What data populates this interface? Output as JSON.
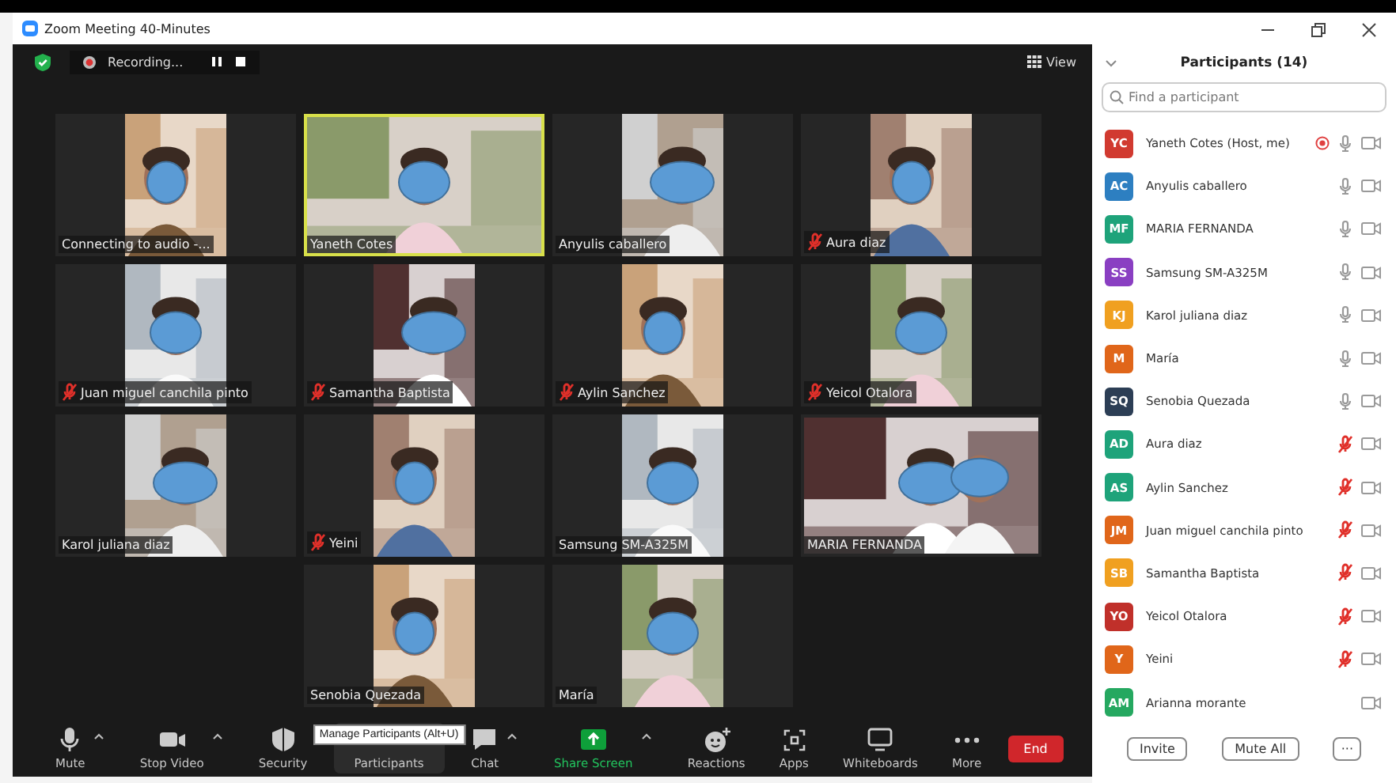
{
  "window": {
    "title": "Zoom Meeting 40-Minutes"
  },
  "meeting_bar": {
    "recording": {
      "label": "Recording..."
    },
    "view_button": "View"
  },
  "video_rows": [
    {
      "tiles": [
        {
          "name": "Connecting to audio -...",
          "muted": false,
          "speaking": false,
          "kind": "narrow"
        },
        {
          "name": "Yaneth Cotes",
          "muted": false,
          "speaking": true,
          "kind": "wide"
        },
        {
          "name": "Anyulis caballero",
          "muted": false,
          "speaking": false,
          "kind": "narrow"
        },
        {
          "name": "Aura diaz",
          "muted": true,
          "speaking": false,
          "kind": "narrow"
        }
      ]
    },
    {
      "tiles": [
        {
          "name": "Juan miguel canchila pinto",
          "muted": true,
          "speaking": false,
          "kind": "narrow"
        },
        {
          "name": "Samantha Baptista",
          "muted": true,
          "speaking": false,
          "kind": "narrow"
        },
        {
          "name": "Aylin Sanchez",
          "muted": true,
          "speaking": false,
          "kind": "narrow"
        },
        {
          "name": "Yeicol Otalora",
          "muted": true,
          "speaking": false,
          "kind": "narrow"
        }
      ]
    },
    {
      "tiles": [
        {
          "name": "Karol juliana diaz",
          "muted": false,
          "speaking": false,
          "kind": "narrow"
        },
        {
          "name": "Yeini",
          "muted": true,
          "speaking": false,
          "kind": "narrow"
        },
        {
          "name": "Samsung SM-A325M",
          "muted": false,
          "speaking": false,
          "kind": "narrow"
        },
        {
          "name": "MARIA FERNANDA",
          "muted": false,
          "speaking": false,
          "kind": "wide"
        }
      ]
    },
    {
      "tiles": [
        {
          "name": "Senobia Quezada",
          "muted": false,
          "speaking": false,
          "kind": "narrow"
        },
        {
          "name": "María",
          "muted": false,
          "speaking": false,
          "kind": "narrow"
        }
      ]
    }
  ],
  "toolbar": {
    "buttons": [
      {
        "label": "Mute",
        "selected": false,
        "color": "#c8c8c8",
        "caret": true
      },
      {
        "label": "Stop Video",
        "selected": false,
        "color": "#c8c8c8",
        "caret": true
      },
      {
        "label": "Security",
        "selected": false,
        "color": "#c8c8c8",
        "caret": false
      },
      {
        "label": "Participants",
        "selected": true,
        "color": "#c8c8c8",
        "caret": false
      },
      {
        "label": "Chat",
        "selected": false,
        "color": "#c8c8c8",
        "caret": true
      },
      {
        "label": "Share Screen",
        "selected": false,
        "color": "#22c55e",
        "caret": true
      },
      {
        "label": "Reactions",
        "selected": false,
        "color": "#c8c8c8",
        "caret": false
      },
      {
        "label": "Apps",
        "selected": false,
        "color": "#c8c8c8",
        "caret": false
      },
      {
        "label": "Whiteboards",
        "selected": false,
        "color": "#c8c8c8",
        "caret": false
      },
      {
        "label": "More",
        "selected": false,
        "color": "#c8c8c8",
        "caret": false
      }
    ],
    "tooltip": "Manage Participants (Alt+U)",
    "end_button": "End"
  },
  "participants_panel": {
    "title": "Participants (14)",
    "search": {
      "placeholder": "Find a participant"
    },
    "participants": [
      {
        "initials": "YC",
        "name": "Yaneth Cotes (Host, me)",
        "color": "#d13a30",
        "muted": false,
        "has_audio": true,
        "recording": true
      },
      {
        "initials": "AC",
        "name": "Anyulis caballero",
        "color": "#2d7fc1",
        "muted": false,
        "has_audio": true,
        "recording": false
      },
      {
        "initials": "MF",
        "name": "MARIA FERNANDA",
        "color": "#1ea37a",
        "muted": false,
        "has_audio": true,
        "recording": false
      },
      {
        "initials": "SS",
        "name": "Samsung SM-A325M",
        "color": "#8a3fc2",
        "muted": false,
        "has_audio": true,
        "recording": false
      },
      {
        "initials": "KJ",
        "name": "Karol juliana diaz",
        "color": "#f0a020",
        "muted": false,
        "has_audio": true,
        "recording": false
      },
      {
        "initials": "M",
        "name": "María",
        "color": "#e0661a",
        "muted": false,
        "has_audio": true,
        "recording": false
      },
      {
        "initials": "SQ",
        "name": "Senobia Quezada",
        "color": "#2c3e55",
        "muted": false,
        "has_audio": true,
        "recording": false
      },
      {
        "initials": "AD",
        "name": "Aura diaz",
        "color": "#1ea37a",
        "muted": true,
        "has_audio": true,
        "recording": false
      },
      {
        "initials": "AS",
        "name": "Aylin Sanchez",
        "color": "#1ea37a",
        "muted": true,
        "has_audio": true,
        "recording": false
      },
      {
        "initials": "JM",
        "name": "Juan miguel canchila pinto",
        "color": "#e0661a",
        "muted": true,
        "has_audio": true,
        "recording": false
      },
      {
        "initials": "SB",
        "name": "Samantha Baptista",
        "color": "#f0a020",
        "muted": true,
        "has_audio": true,
        "recording": false
      },
      {
        "initials": "YO",
        "name": "Yeicol Otalora",
        "color": "#c0302a",
        "muted": true,
        "has_audio": true,
        "recording": false
      },
      {
        "initials": "Y",
        "name": "Yeini",
        "color": "#e0661a",
        "muted": true,
        "has_audio": true,
        "recording": false
      },
      {
        "initials": "AM",
        "name": "Arianna morante",
        "color": "#25a860",
        "has_audio": false,
        "recording": false
      }
    ],
    "buttons": [
      "Invite",
      "Mute All"
    ],
    "more_button": "···"
  }
}
